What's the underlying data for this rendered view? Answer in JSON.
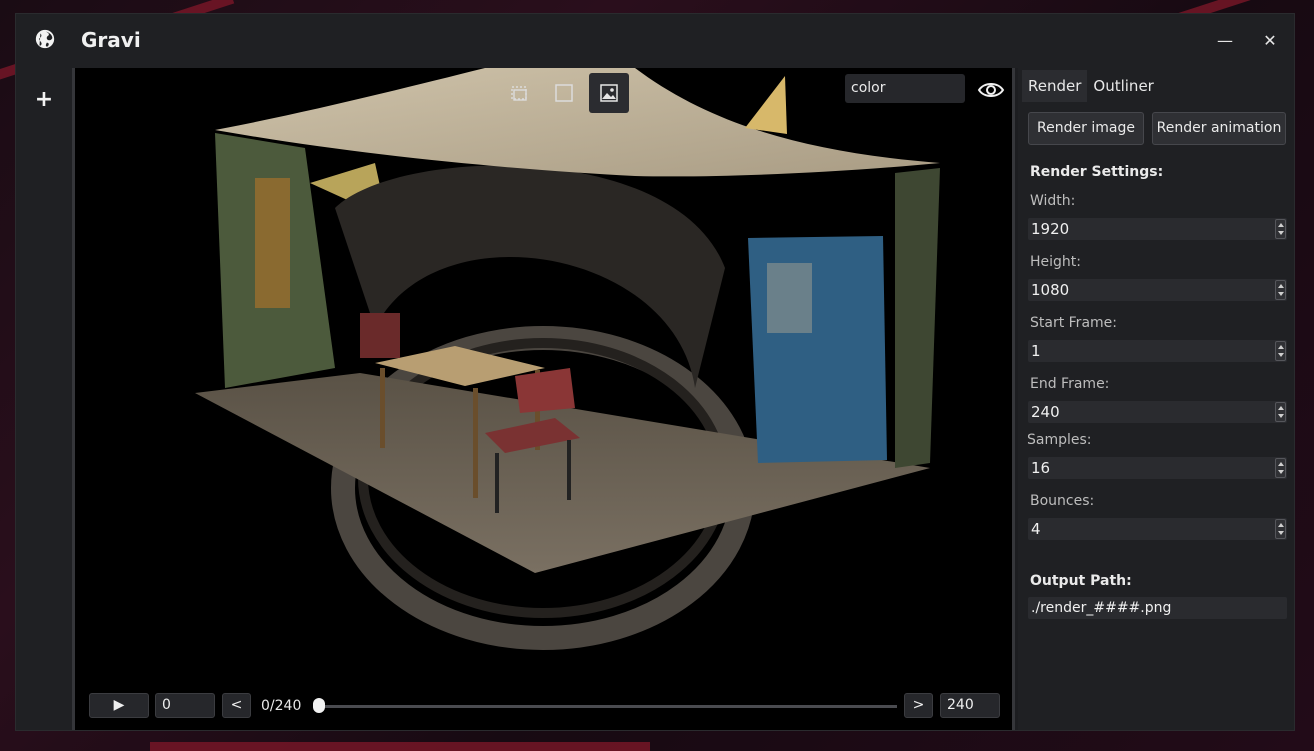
{
  "app": {
    "title": "Gravi"
  },
  "window_controls": {
    "minimize": "—",
    "close": "✕"
  },
  "sidebar": {
    "add_label": "+"
  },
  "viewport": {
    "tools": [
      "select-region-icon",
      "frame-icon",
      "image-icon"
    ],
    "active_tool": "image-icon",
    "pass_select": {
      "value": "color"
    }
  },
  "timeline": {
    "play_label": "▶",
    "current_frame_value": "0",
    "prev_label": "<",
    "frame_readout": "0/240",
    "next_label": ">",
    "end_frame_value": "240",
    "progress": 0
  },
  "panel": {
    "tabs": [
      {
        "label": "Render",
        "active": true
      },
      {
        "label": "Outliner",
        "active": false
      }
    ],
    "render_image_label": "Render image",
    "render_animation_label": "Render animation",
    "settings_title": "Render Settings:",
    "fields": [
      {
        "label": "Width:",
        "value": "1920"
      },
      {
        "label": "Height:",
        "value": "1080"
      },
      {
        "label": "Start Frame:",
        "value": "1"
      },
      {
        "label": "End Frame:",
        "value": "240"
      },
      {
        "label": "Samples:",
        "value": "16"
      },
      {
        "label": "Bounces:",
        "value": "4"
      }
    ],
    "output_label": "Output Path:",
    "output_value": "./render_####.png"
  },
  "colors": {
    "window_bg": "#1c1d20",
    "panel_bg": "#1f2023",
    "viewport_bg": "#000000",
    "accent": "#2b2c30"
  }
}
